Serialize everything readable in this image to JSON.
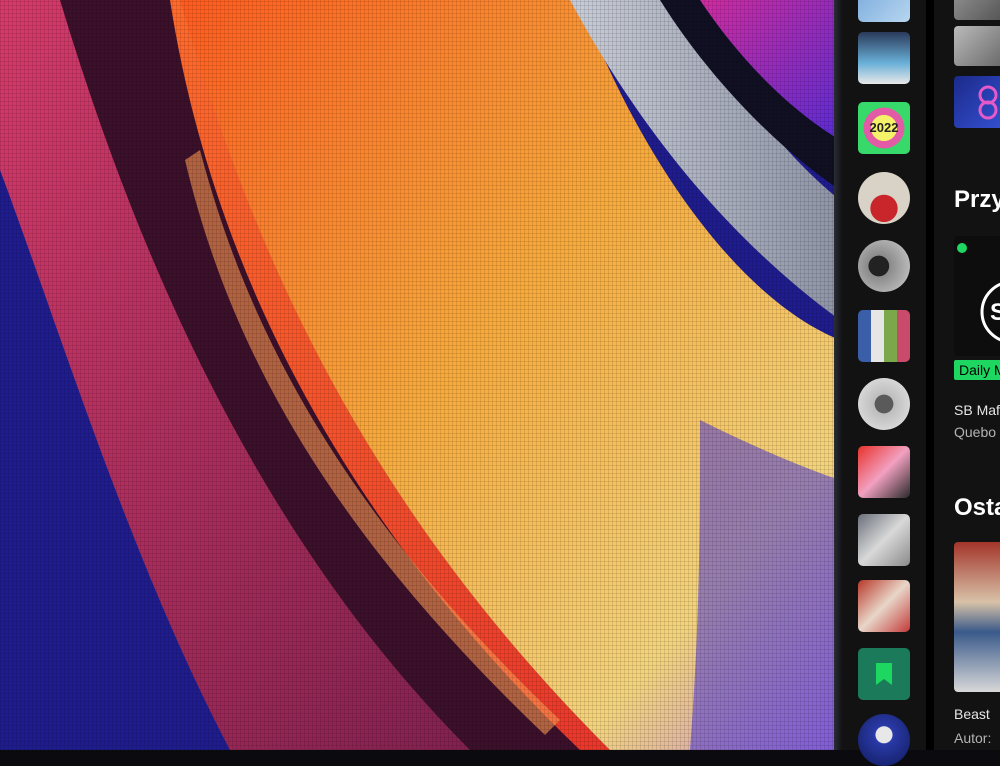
{
  "library": {
    "items": [
      {
        "name": "playlist-cover-1"
      },
      {
        "name": "daily-mix-cover"
      },
      {
        "name": "wrapped-2022-cover",
        "text": "2022"
      },
      {
        "name": "artist-avatar-1"
      },
      {
        "name": "artist-avatar-2"
      },
      {
        "name": "playlist-cover-collage"
      },
      {
        "name": "artist-avatar-3"
      },
      {
        "name": "playlist-cover-red"
      },
      {
        "name": "playlist-cover-gray"
      },
      {
        "name": "playlist-cover-photo"
      },
      {
        "name": "your-episodes",
        "icon": "bookmark-icon"
      },
      {
        "name": "artist-avatar-4"
      }
    ]
  },
  "main": {
    "section1_title": "Przy",
    "daily_badge": "Daily M",
    "card1_line1": "SB Maf",
    "card1_line2": "Quebo",
    "section2_title": "Osta",
    "card2_line1": "Beast",
    "card2_line2": "Autor:"
  },
  "colors": {
    "spotify_green": "#1ed760",
    "panel_bg": "#121212",
    "wallpaper_blue": "#1c1a8a"
  }
}
